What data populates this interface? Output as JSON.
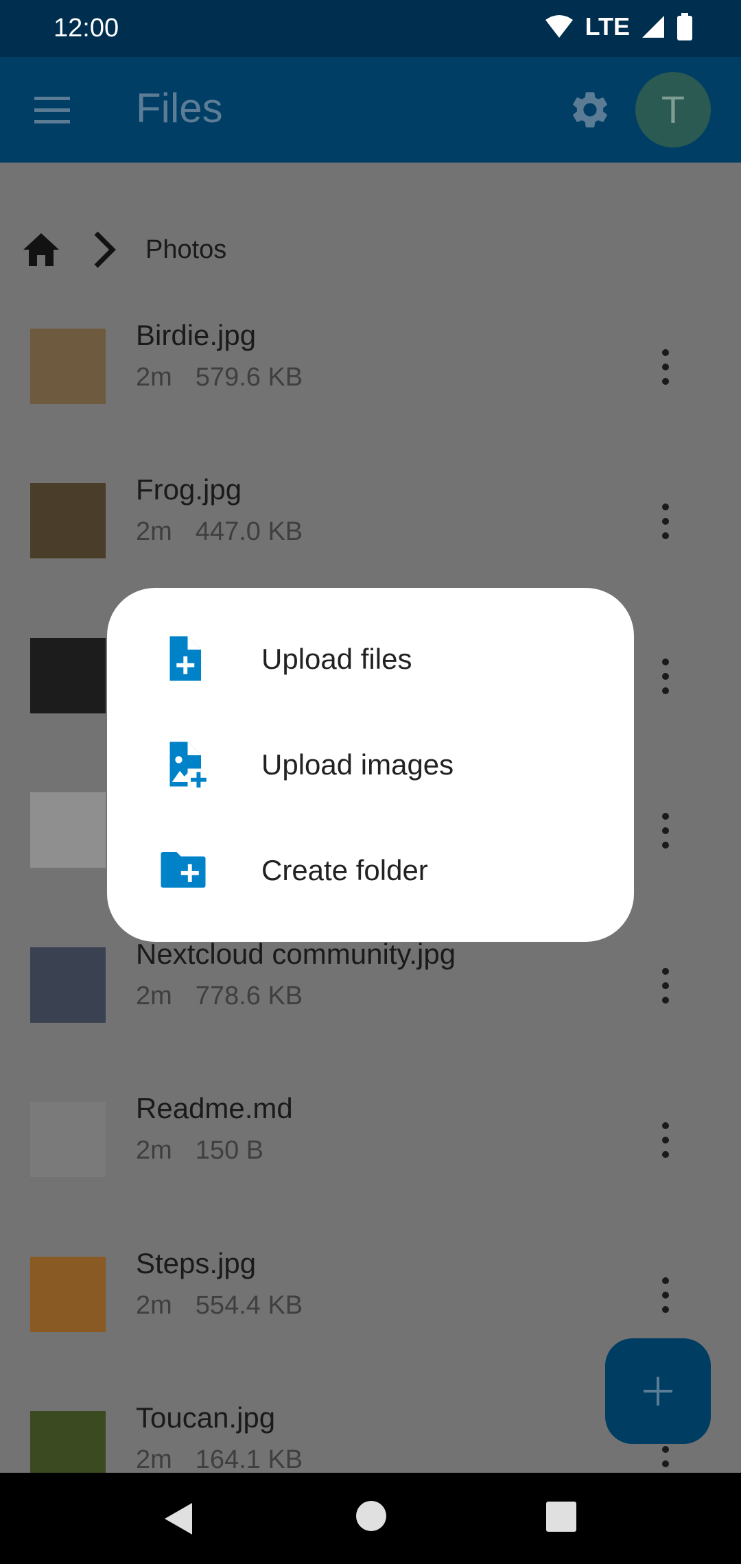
{
  "status_bar": {
    "time": "12:00",
    "network": "LTE"
  },
  "app_bar": {
    "title": "Files",
    "avatar_initial": "T"
  },
  "breadcrumb": {
    "current": "Photos"
  },
  "files": [
    {
      "name": "Birdie.jpg",
      "age": "2m",
      "size": "579.6 KB",
      "thumb_color": "#6e5a3e"
    },
    {
      "name": "Frog.jpg",
      "age": "2m",
      "size": "447.0 KB",
      "thumb_color": "#4a3d2a"
    },
    {
      "name": "",
      "age": "",
      "size": "",
      "thumb_color": "#1c1c1c"
    },
    {
      "name": "",
      "age": "",
      "size": "",
      "thumb_color": "#8f8f8f"
    },
    {
      "name": "Nextcloud community.jpg",
      "age": "2m",
      "size": "778.6 KB",
      "thumb_color": "#3a4252"
    },
    {
      "name": "Readme.md",
      "age": "2m",
      "size": "150 B",
      "thumb_color": "#7a7a7a"
    },
    {
      "name": "Steps.jpg",
      "age": "2m",
      "size": "554.4 KB",
      "thumb_color": "#8a5a24"
    },
    {
      "name": "Toucan.jpg",
      "age": "2m",
      "size": "164.1 KB",
      "thumb_color": "#3c4a22"
    }
  ],
  "dialog": {
    "items": [
      {
        "label": "Upload files",
        "icon": "upload-file-icon"
      },
      {
        "label": "Upload images",
        "icon": "upload-image-icon"
      },
      {
        "label": "Create folder",
        "icon": "create-folder-icon"
      }
    ]
  },
  "colors": {
    "accent": "#0082c9",
    "app_bar": "#003e65",
    "status_bar": "#002e4e",
    "scrim_background": "#737373"
  }
}
